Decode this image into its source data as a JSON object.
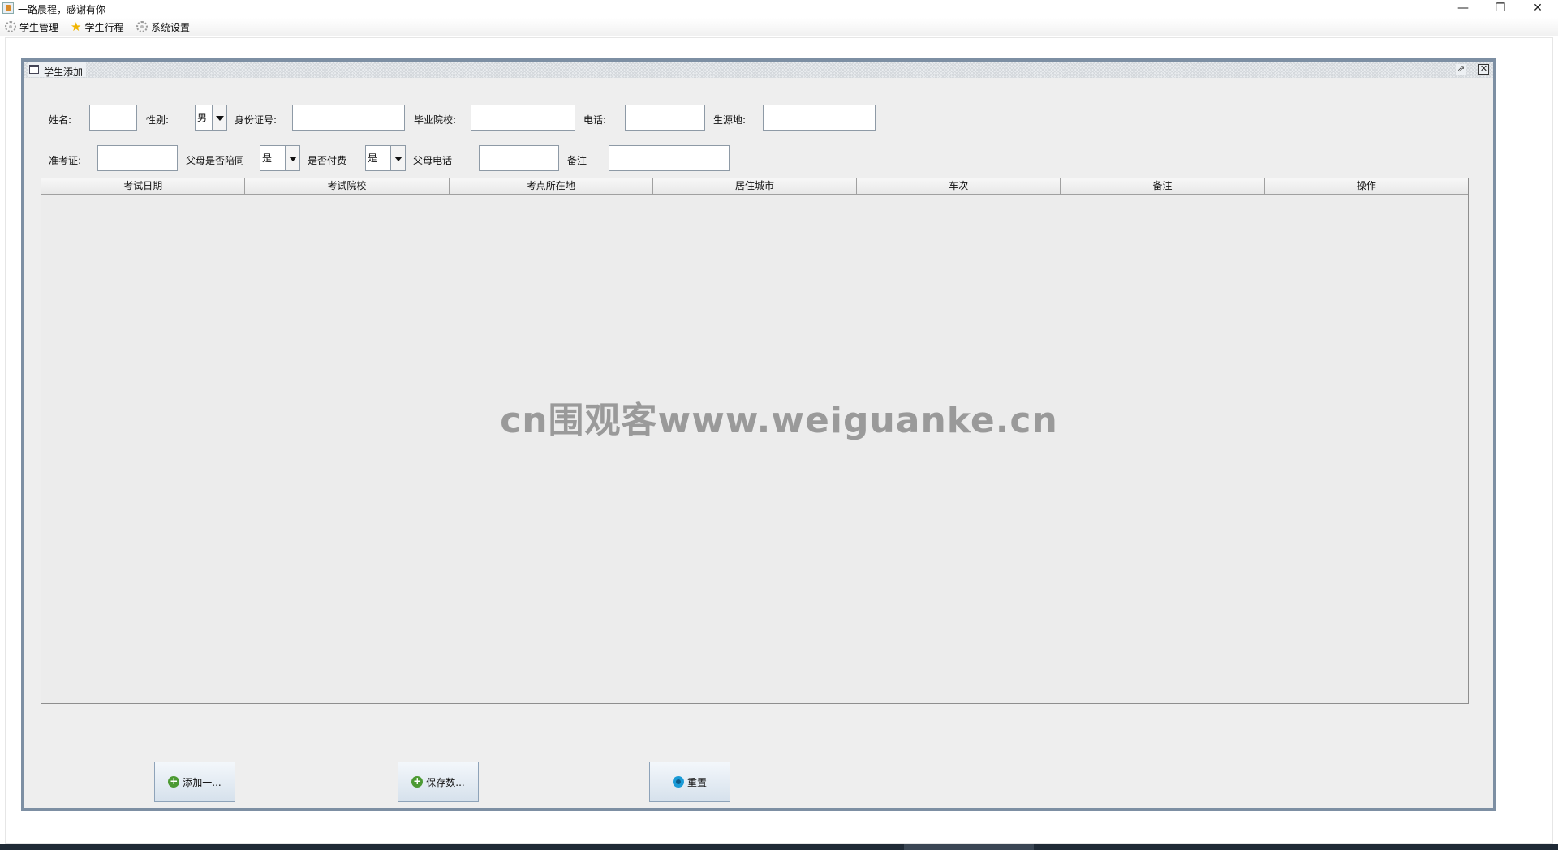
{
  "window": {
    "title": "一路晨程，感谢有你"
  },
  "menu": [
    {
      "label": "学生管理",
      "icon": "gear-icon"
    },
    {
      "label": "学生行程",
      "icon": "star-icon"
    },
    {
      "label": "系统设置",
      "icon": "gear-icon"
    }
  ],
  "frame": {
    "title": "学生添加"
  },
  "form": {
    "name_label": "姓名:",
    "name_value": "",
    "gender_label": "性别:",
    "gender_value": "男",
    "idcard_label": "身份证号:",
    "idcard_value": "",
    "school_label": "毕业院校:",
    "school_value": "",
    "phone_label": "电话:",
    "phone_value": "",
    "origin_label": "生源地:",
    "origin_value": "",
    "ticket_label": "准考证:",
    "ticket_value": "",
    "parents_label": "父母是否陪同",
    "parents_value": "是",
    "paid_label": "是否付费",
    "paid_value": "是",
    "parent_phone_label": "父母电话",
    "parent_phone_value": "",
    "remark_label": "备注",
    "remark_value": ""
  },
  "table": {
    "columns": [
      "考试日期",
      "考试院校",
      "考点所在地",
      "居住城市",
      "车次",
      "备注",
      "操作"
    ],
    "rows": []
  },
  "watermark": "cn围观客www.weiguanke.cn",
  "buttons": {
    "add": "添加一...",
    "save": "保存数...",
    "reset": "重置"
  },
  "colors": {
    "frame_border": "#7d8fa3",
    "button_gradient": "#d6e1ec",
    "add_icon": "#4c9a33",
    "reset_icon": "#1a9bd7"
  }
}
